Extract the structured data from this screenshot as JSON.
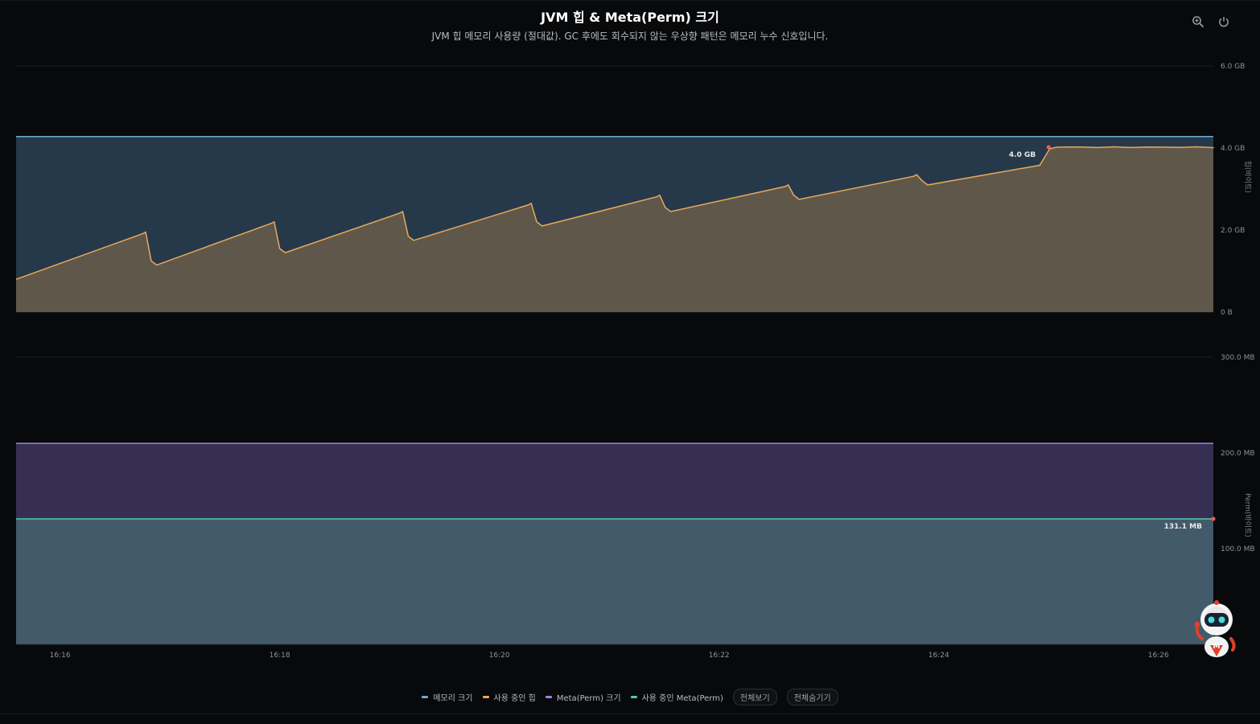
{
  "header": {
    "title": "JVM 힙 & Meta(Perm) 크기",
    "subtitle": "JVM 힙 메모리 사용량 (절대값). GC 후에도 회수되지 않는 우상향 패턴은 메모리 누수 신호입니다."
  },
  "toolbar": {
    "zoom_icon": "zoom-icon",
    "reset_icon": "power-reset-icon"
  },
  "colors": {
    "heap_size": "#6aaed0",
    "heap_used": "#e9a85a",
    "meta_size": "#9b82e6",
    "meta_used": "#4fc9a8",
    "marker": "#ff5a4f"
  },
  "chart_data": [
    {
      "type": "area",
      "ylabel": "힙(바이트)",
      "ylim": [
        0,
        6.0
      ],
      "unit": "GB",
      "yticks": [
        "0 B",
        "2.0 GB",
        "4.0 GB",
        "6.0 GB"
      ],
      "x_range": [
        "16:15.6",
        "16:26.5"
      ],
      "series": [
        {
          "name": "메모리 크기",
          "values_gb": 4.28
        },
        {
          "name": "사용 중인 힙",
          "gc_drop_times": [
            "16:16.78",
            "16:17.95",
            "16:19.12",
            "16:20.29",
            "16:21.46",
            "16:22.63",
            "16:23.80"
          ],
          "peak_gb": [
            1.95,
            2.2,
            2.45,
            2.65,
            2.85,
            3.1,
            3.35
          ],
          "post_gc_gb": [
            1.15,
            1.45,
            1.75,
            2.1,
            2.45,
            2.75,
            3.1
          ],
          "start_gb": 0.8,
          "jump_time": "16:24.95",
          "plateau_gb": 4.02
        }
      ],
      "annotation": {
        "label": "4.0 GB",
        "time": "16:25.0",
        "value": 4.02
      }
    },
    {
      "type": "area",
      "ylabel": "Perm(바이트)",
      "ylim": [
        0,
        300.0
      ],
      "unit": "MB",
      "yticks": [
        "100.0 MB",
        "200.0 MB",
        "300.0 MB"
      ],
      "series": [
        {
          "name": "Meta(Perm) 크기",
          "value_mb": 210
        },
        {
          "name": "사용 중인 Meta(Perm)",
          "value_mb": 131.1
        }
      ],
      "annotation": {
        "label": "131.1 MB",
        "time": "16:26.5",
        "value": 131.1
      }
    }
  ],
  "x_axis": {
    "ticks": [
      "16:16",
      "16:18",
      "16:20",
      "16:22",
      "16:24",
      "16:26"
    ]
  },
  "legend": {
    "items": [
      "메모리 크기",
      "사용 중인 힙",
      "Meta(Perm) 크기",
      "사용 중인 Meta(Perm)"
    ],
    "show_all": "전체보기",
    "hide_all": "전체숨기기"
  }
}
